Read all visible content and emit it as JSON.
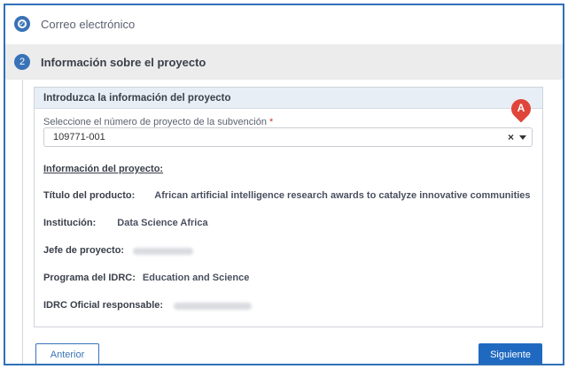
{
  "step1": {
    "label": "Correo electrónico",
    "status_icon": "check-circle-icon"
  },
  "step2": {
    "number": "2",
    "label": "Información sobre el proyecto"
  },
  "panel": {
    "title": "Introduzca la información del proyecto",
    "field": {
      "label": "Seleccione el número de proyecto de la subvención",
      "required_mark": "*",
      "value": "109771-001",
      "clear_glyph": "×"
    },
    "marker_letter": "A",
    "info_title": "Información del proyecto:",
    "rows": [
      {
        "key": "Título del producto:",
        "value": "African artificial intelligence research awards to catalyze innovative communities"
      },
      {
        "key": "Institución:",
        "value": "Data Science Africa"
      },
      {
        "key": "Jefe de proyecto:",
        "value": ""
      },
      {
        "key": "Programa del IDRC:",
        "value": "Education and Science"
      },
      {
        "key": "IDRC Oficial responsable:",
        "value": ""
      }
    ]
  },
  "buttons": {
    "prev": "Anterior",
    "next": "Siguiente"
  },
  "colors": {
    "accent": "#1f6ac0",
    "marker": "#e0453a",
    "header_bg": "#ececec"
  }
}
